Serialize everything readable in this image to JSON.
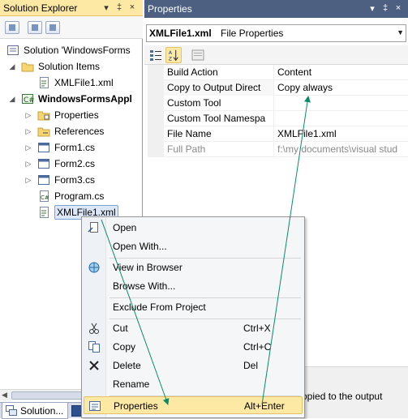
{
  "solution_explorer": {
    "title": "Solution Explorer",
    "pin_label": "▾ ‡ ×",
    "tree": [
      {
        "label": "Solution 'WindowsForms",
        "icon": "solution-icon",
        "expander": "",
        "level": 0,
        "bold": false,
        "selected": false
      },
      {
        "label": "Solution Items",
        "icon": "folder-icon",
        "expander": "◢",
        "level": 1,
        "bold": false,
        "selected": false
      },
      {
        "label": "XMLFile1.xml",
        "icon": "xml-file-icon",
        "expander": "",
        "level": 2,
        "bold": false,
        "selected": false
      },
      {
        "label": "WindowsFormsAppl",
        "icon": "csharp-project-icon",
        "expander": "◢",
        "level": 1,
        "bold": true,
        "selected": false
      },
      {
        "label": "Properties",
        "icon": "properties-folder-icon",
        "expander": "▷",
        "level": 2,
        "bold": false,
        "selected": false
      },
      {
        "label": "References",
        "icon": "references-icon",
        "expander": "▷",
        "level": 2,
        "bold": false,
        "selected": false
      },
      {
        "label": "Form1.cs",
        "icon": "form-icon",
        "expander": "▷",
        "level": 2,
        "bold": false,
        "selected": false
      },
      {
        "label": "Form2.cs",
        "icon": "form-icon",
        "expander": "▷",
        "level": 2,
        "bold": false,
        "selected": false
      },
      {
        "label": "Form3.cs",
        "icon": "form-icon",
        "expander": "▷",
        "level": 2,
        "bold": false,
        "selected": false
      },
      {
        "label": "Program.cs",
        "icon": "csharp-file-icon",
        "expander": "",
        "level": 2,
        "bold": false,
        "selected": false
      },
      {
        "label": "XMLFile1.xml",
        "icon": "xml-file-icon",
        "expander": "",
        "level": 2,
        "bold": false,
        "selected": true
      }
    ],
    "tab_label": "Solution..."
  },
  "properties": {
    "title": "Properties",
    "object_name": "XMLFile1.xml",
    "object_kind": "File Properties",
    "rows": [
      {
        "name": "Build Action",
        "value": "Content",
        "gray": false
      },
      {
        "name": "Copy to Output Direct",
        "value": "Copy always",
        "gray": false
      },
      {
        "name": "Custom Tool",
        "value": "",
        "gray": false
      },
      {
        "name": "Custom Tool Namespa",
        "value": "",
        "gray": false
      },
      {
        "name": "File Name",
        "value": "XMLFile1.xml",
        "gray": false
      },
      {
        "name": "Full Path",
        "value": "f:\\my documents\\visual stud",
        "gray": true
      }
    ],
    "description": "opied to the output"
  },
  "context_menu": {
    "items": [
      {
        "type": "item",
        "label": "Open",
        "shortcut": "",
        "icon": "open-icon",
        "active": false
      },
      {
        "type": "item",
        "label": "Open With...",
        "shortcut": "",
        "icon": "",
        "active": false
      },
      {
        "type": "sep"
      },
      {
        "type": "item",
        "label": "View in Browser",
        "shortcut": "",
        "icon": "browser-icon",
        "active": false
      },
      {
        "type": "item",
        "label": "Browse With...",
        "shortcut": "",
        "icon": "",
        "active": false
      },
      {
        "type": "sep"
      },
      {
        "type": "item",
        "label": "Exclude From Project",
        "shortcut": "",
        "icon": "",
        "active": false
      },
      {
        "type": "sep"
      },
      {
        "type": "item",
        "label": "Cut",
        "shortcut": "Ctrl+X",
        "icon": "cut-icon",
        "active": false
      },
      {
        "type": "item",
        "label": "Copy",
        "shortcut": "Ctrl+C",
        "icon": "copy-icon",
        "active": false
      },
      {
        "type": "item",
        "label": "Delete",
        "shortcut": "Del",
        "icon": "delete-icon",
        "active": false
      },
      {
        "type": "item",
        "label": "Rename",
        "shortcut": "",
        "icon": "",
        "active": false
      },
      {
        "type": "sep"
      },
      {
        "type": "item",
        "label": "Properties",
        "shortcut": "Alt+Enter",
        "icon": "properties-icon",
        "active": true
      }
    ]
  },
  "colors": {
    "active_title": "#fde9a4",
    "inactive_title": "#4d6082",
    "annotation_arrow": "#0a8a6a"
  }
}
